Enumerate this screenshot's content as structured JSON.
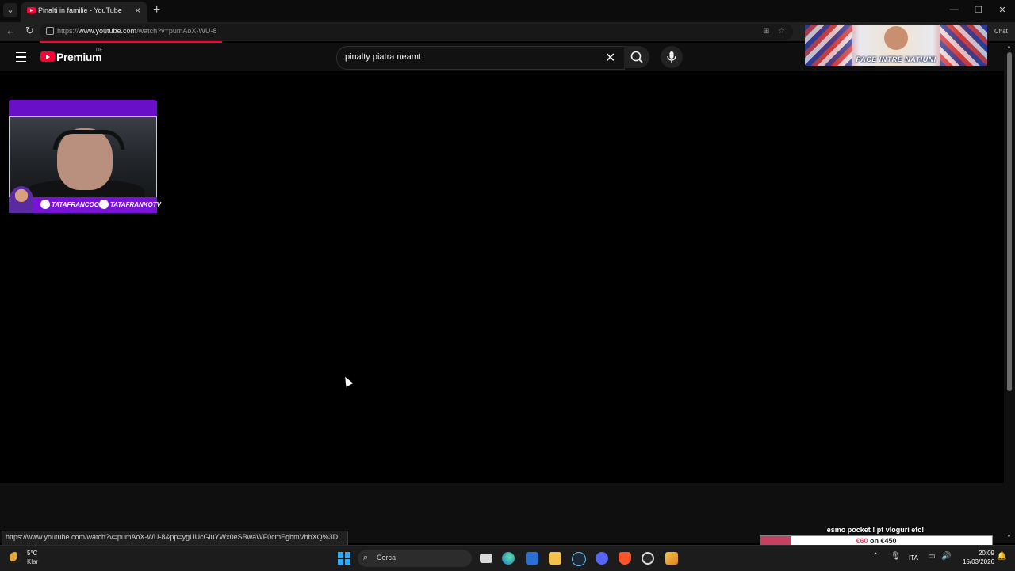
{
  "browser": {
    "tab_title": "Pinalti in familie - YouTube",
    "tab_close": "×",
    "new_tab": "+",
    "tab_dropdown": "⌄",
    "url_prefix": "https://",
    "url_host": "www.youtube.com",
    "url_path": "/watch?v=pumAoX-WU-8",
    "chat_label": "Chat",
    "window_controls": {
      "minimize": "—",
      "maximize": "❐",
      "close": "✕"
    }
  },
  "youtube": {
    "logo_text": "Premium",
    "country_code": "DE",
    "search_query": "pinalty piatra neamt",
    "clear_icon": "✕",
    "search_icon": "search-icon",
    "mic_icon": "mic-icon"
  },
  "overlay_banner": {
    "text": "PACE INTRE NATIUNI"
  },
  "webcam_overlay": {
    "instagram_handle": "TATAFRANCOO",
    "tiktok_handle": "TATAFRANKOTV"
  },
  "status_bar": {
    "hover_url": "https://www.youtube.com/watch?v=pumAoX-WU-8&pp=ygUUcGluYWx0eSBwaWF0cmEgbmVhbXQ%3D..."
  },
  "donation_goal": {
    "title": "esmo pocket ! pt vloguri etc!",
    "raised": "€60",
    "separator": "on",
    "target": "€450",
    "progress_fraction": 0.133,
    "fill_color": "#c84060"
  },
  "taskbar": {
    "weather_temp": "5°C",
    "weather_desc": "Klar",
    "search_placeholder": "Cerca",
    "language": "ITA",
    "time": "20:09",
    "date": "15/03/2026",
    "apps": [
      "task-view-icon",
      "edge-icon",
      "store-icon",
      "explorer-icon",
      "steam-icon",
      "discord-icon",
      "brave-icon",
      "obs-icon",
      "app-icon"
    ]
  }
}
